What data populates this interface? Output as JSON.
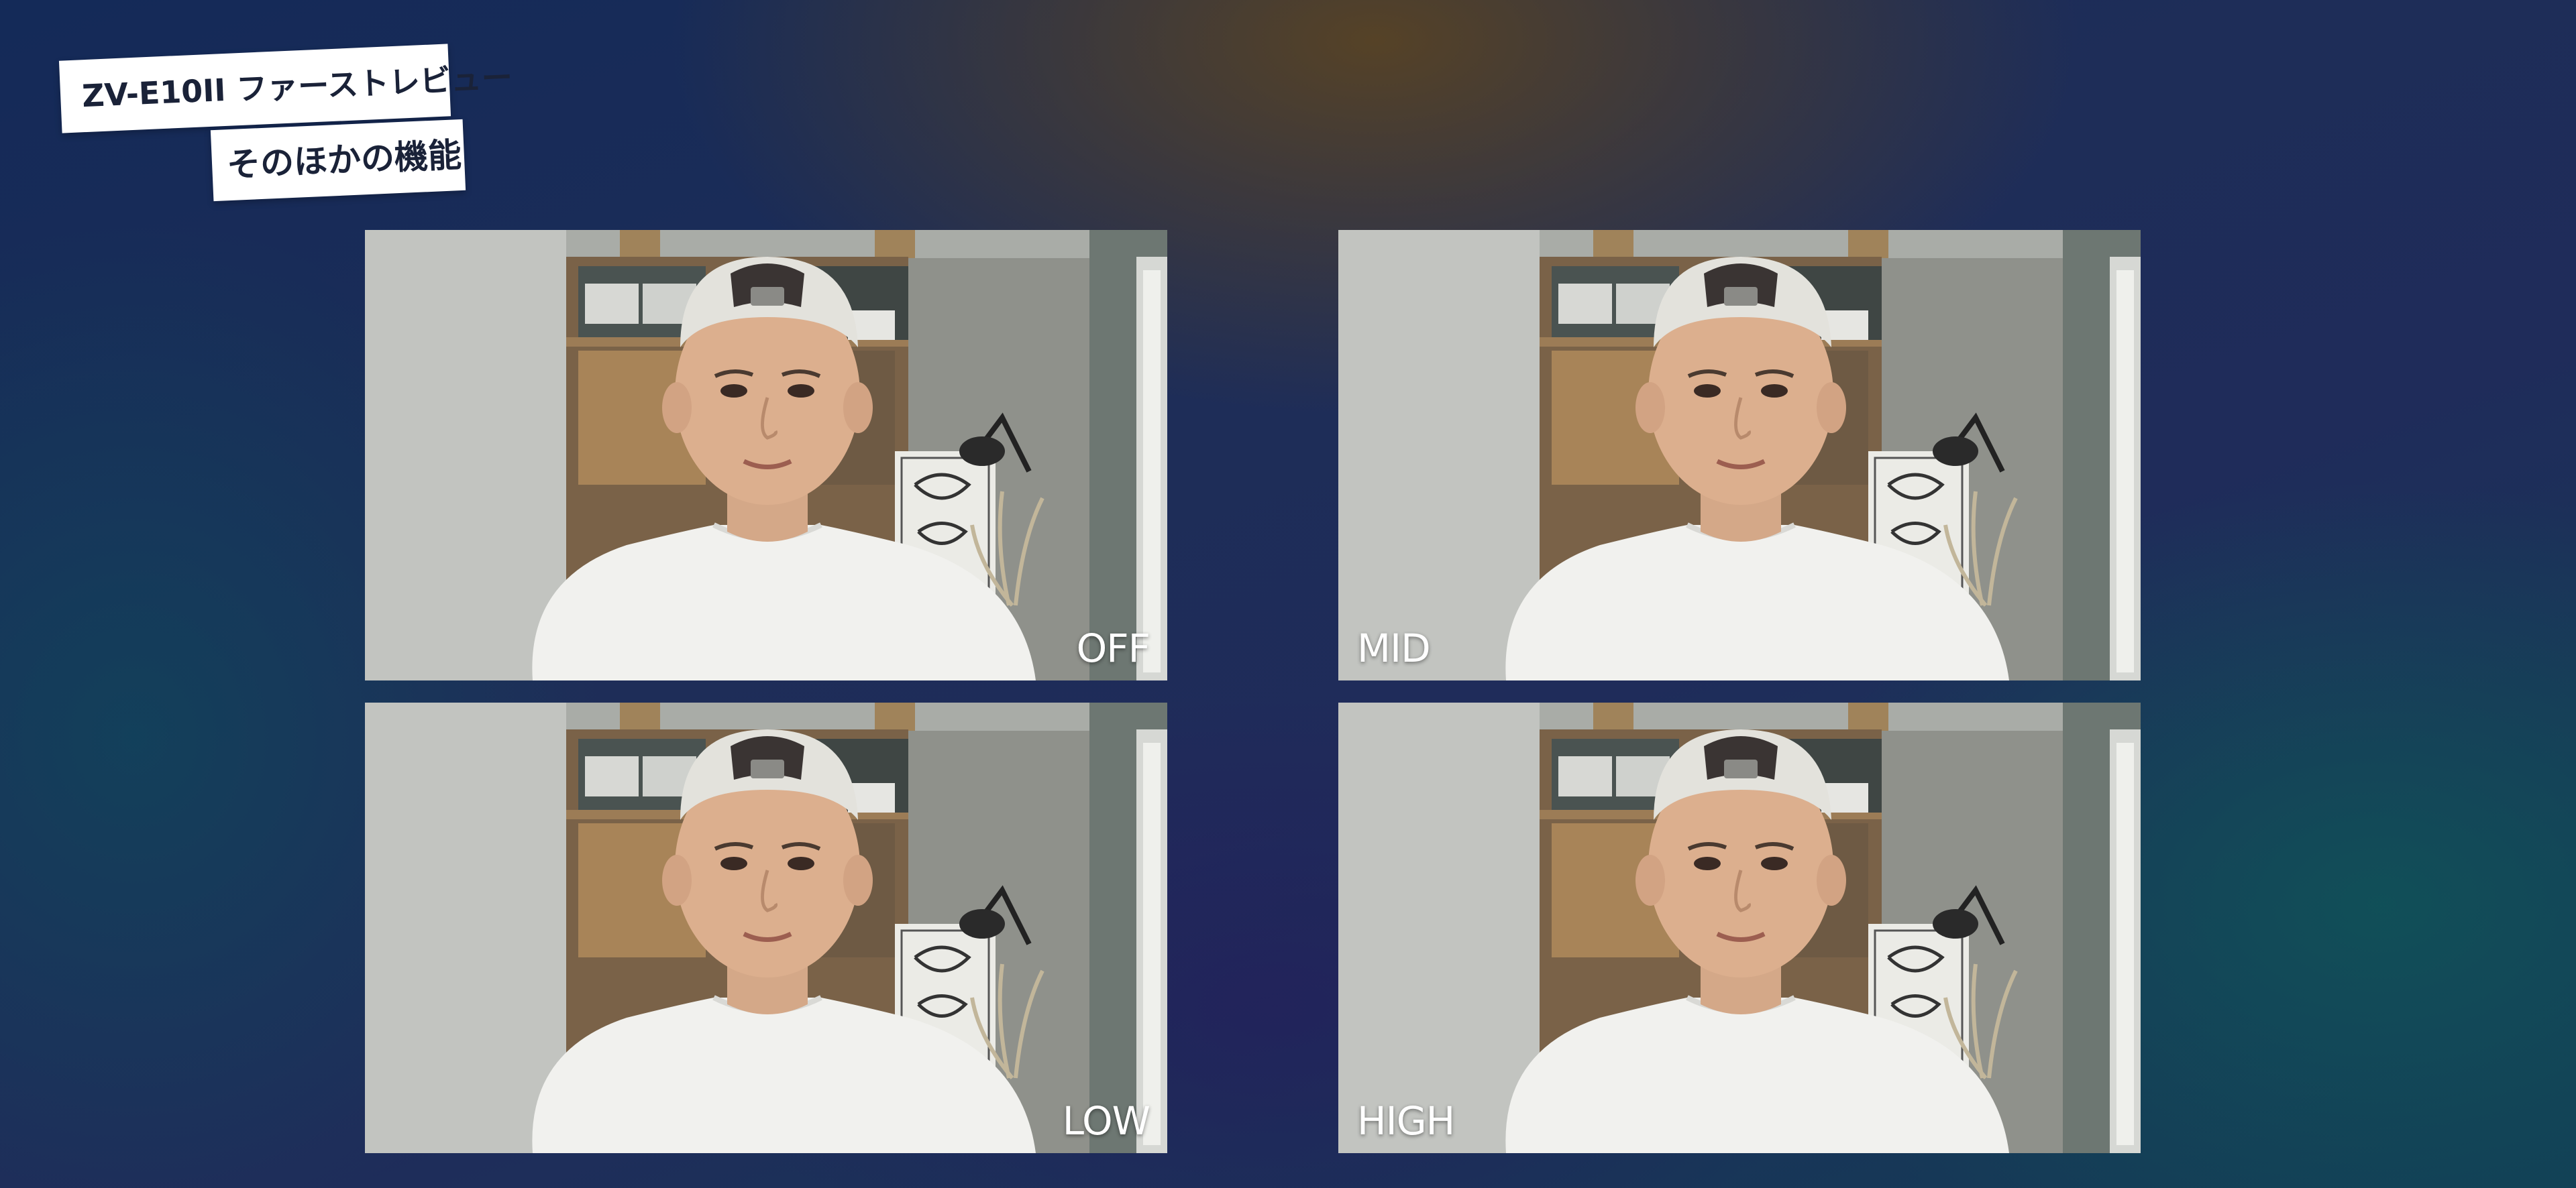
{
  "title": {
    "line1": "ZV-E10II  ファーストレビュー",
    "line2": "そのほかの機能"
  },
  "photos": [
    {
      "label": "OFF"
    },
    {
      "label": "MID"
    },
    {
      "label": "LOW"
    },
    {
      "label": "HIGH"
    }
  ],
  "colors": {
    "background_top": "#1e2d58",
    "accent_warm": "#604620",
    "accent_teal": "#0e5858",
    "label_bg": "#ffffff",
    "label_text": "#1a2238"
  }
}
